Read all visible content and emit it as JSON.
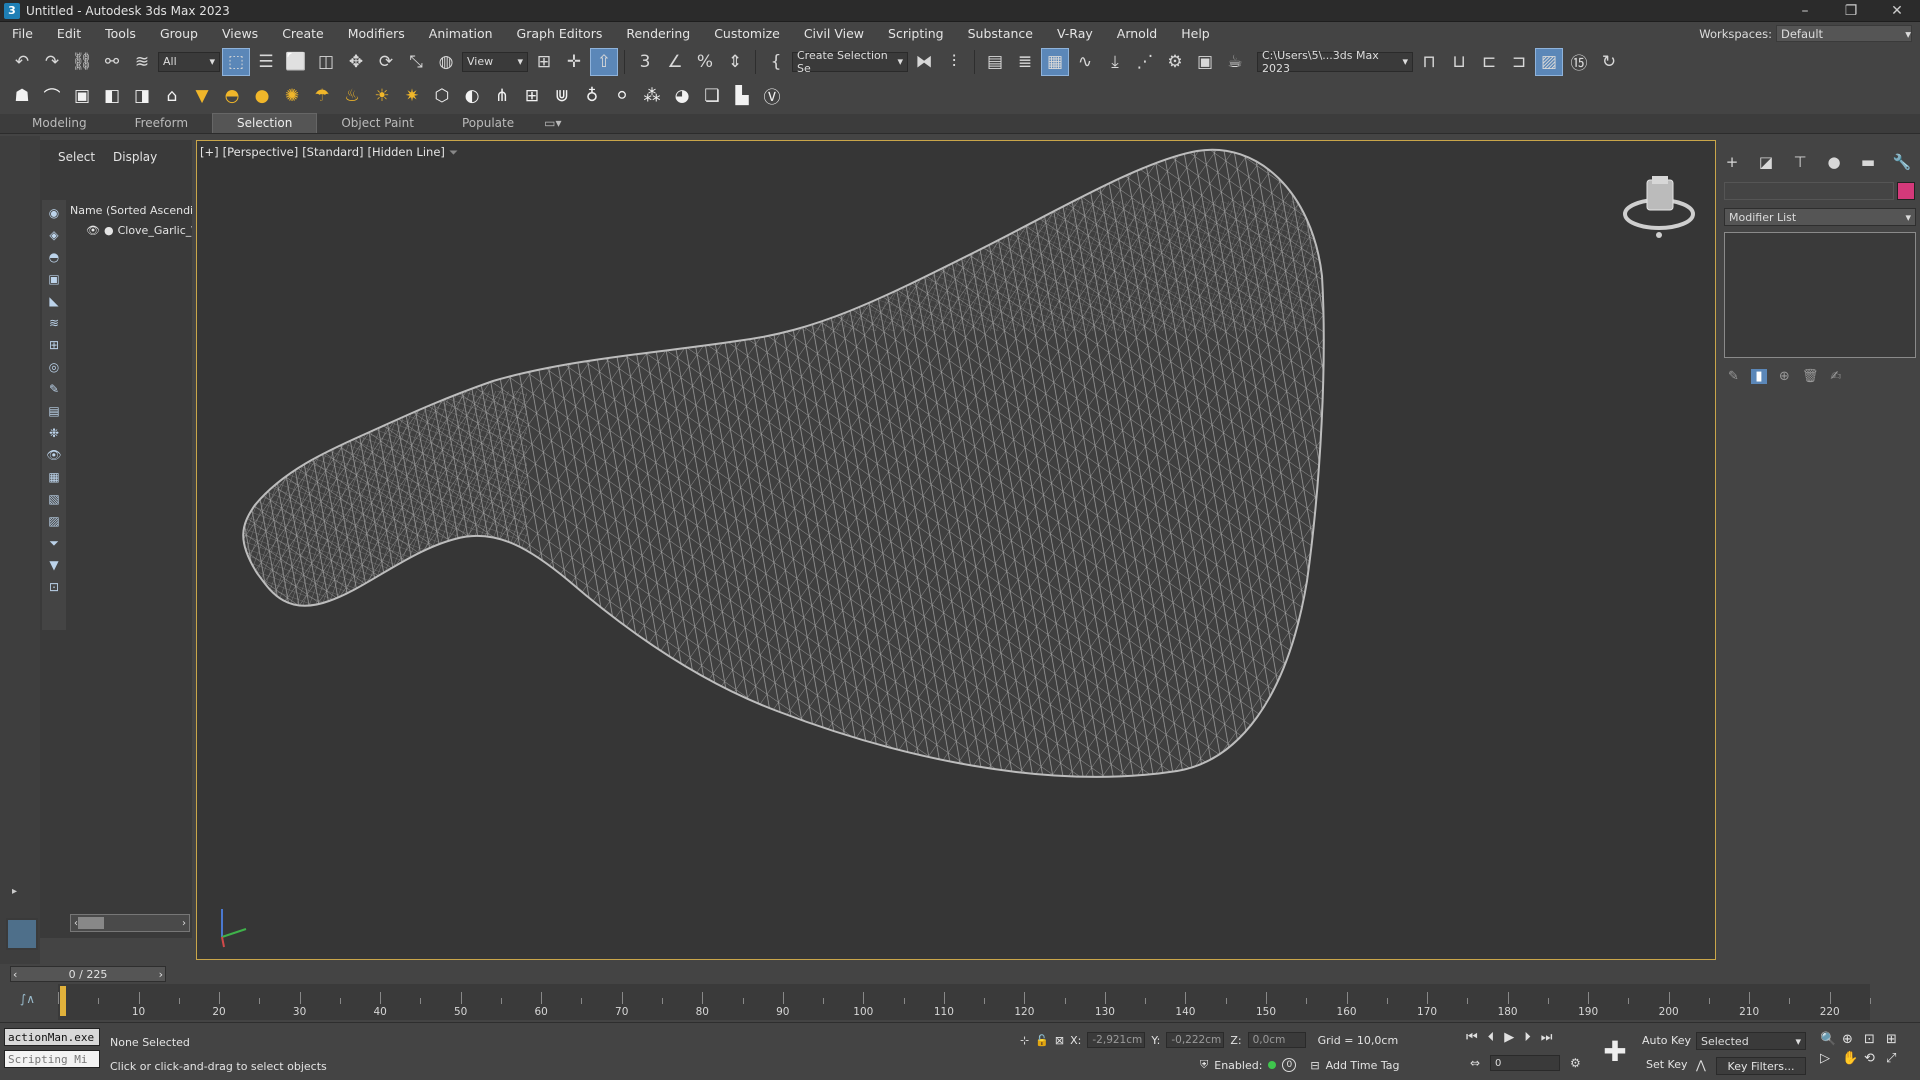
{
  "app": {
    "title": "Untitled - Autodesk 3ds Max 2023",
    "logo": "3"
  },
  "window_controls": [
    "–",
    "❐",
    "✕"
  ],
  "menu": [
    "File",
    "Edit",
    "Tools",
    "Group",
    "Views",
    "Create",
    "Modifiers",
    "Animation",
    "Graph Editors",
    "Rendering",
    "Customize",
    "Civil View",
    "Scripting",
    "Substance",
    "V-Ray",
    "Arnold",
    "Help"
  ],
  "workspace": {
    "label": "Workspaces:",
    "value": "Default"
  },
  "toolbar": {
    "filter": "All",
    "ref_coord": "View",
    "selection_set": "Create Selection Se",
    "project_path": "C:\\Users\\5\\...3ds Max 2023"
  },
  "ribbon_tabs": [
    "Modeling",
    "Freeform",
    "Selection",
    "Object Paint",
    "Populate"
  ],
  "scene_explorer": {
    "tabs": [
      "Select",
      "Display"
    ],
    "header": "Name (Sorted Ascending)",
    "items": [
      "Clove_Garlic_\\"
    ]
  },
  "viewport": {
    "labels": [
      "[+]",
      "[Perspective]",
      "[Standard]",
      "[Hidden Line]"
    ]
  },
  "command_panel": {
    "modifier_list": "Modifier List",
    "object_color": "#d4397a"
  },
  "timeline": {
    "frame_display": "0 / 225",
    "ticks": [
      10,
      20,
      30,
      40,
      50,
      60,
      70,
      80,
      90,
      100,
      110,
      120,
      130,
      140,
      150,
      160,
      170,
      180,
      190,
      200,
      210,
      220
    ],
    "total_frames": 225
  },
  "status": {
    "listener_input": "actionMan.exe",
    "listener_output": "Scripting Mi",
    "selection": "None Selected",
    "prompt": "Click or click-and-drag to select objects",
    "x_label": "X:",
    "x": "-2,921cm",
    "y_label": "Y:",
    "y": "-0,222cm",
    "z_label": "Z:",
    "z": "0,0cm",
    "grid": "Grid = 10,0cm",
    "enabled_label": "Enabled:",
    "enabled_count": "0",
    "add_time_tag": "Add Time Tag",
    "current_frame": "0",
    "auto_key": "Auto Key",
    "set_key": "Set Key",
    "key_mode": "Selected",
    "key_filters": "Key Filters..."
  },
  "colors": {
    "viewport_bg": "#363636",
    "active_border": "#c9a64a",
    "highlight": "#5b87b8"
  }
}
